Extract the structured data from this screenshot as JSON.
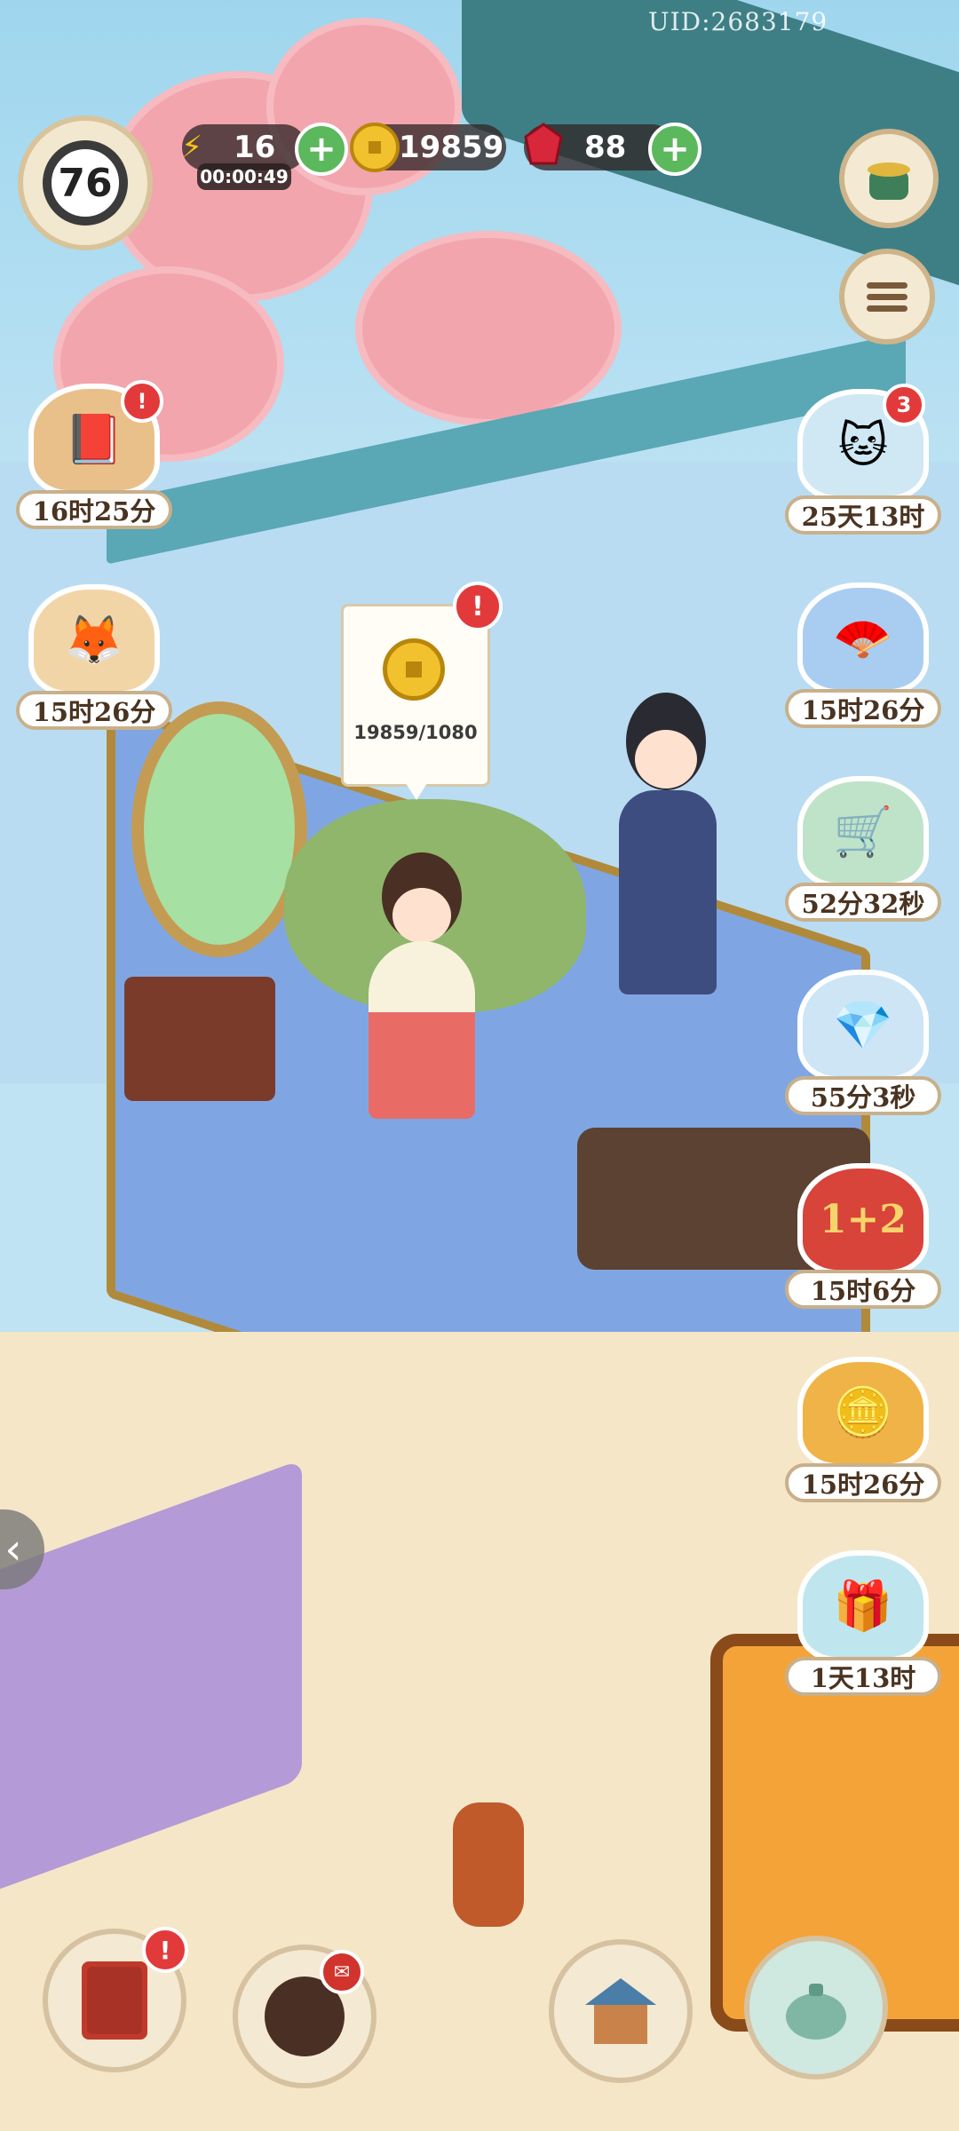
{
  "uid": "UID:2683179",
  "player": {
    "level": "76"
  },
  "resources": {
    "energy": {
      "icon": "lightning-icon",
      "value": "16",
      "timer": "00:00:49"
    },
    "coins": {
      "icon": "coin-icon",
      "value": "19859"
    },
    "gems": {
      "icon": "red-gem-icon",
      "value": "88"
    }
  },
  "tooltip": {
    "value": "19859/1080"
  },
  "left_events": [
    {
      "name": "book-event",
      "timer": "16时25分",
      "alert": "!"
    },
    {
      "name": "fox-event",
      "timer": "15时26分"
    }
  ],
  "right_events": [
    {
      "name": "cat-cloud-event",
      "timer": "25天13时",
      "badge": "3"
    },
    {
      "name": "fan-event",
      "timer": "15时26分"
    },
    {
      "name": "cat-cart-event",
      "timer": "52分32秒"
    },
    {
      "name": "treasure-cloud-event",
      "timer": "55分3秒"
    },
    {
      "name": "bonus-event",
      "timer": "15时6分",
      "art_text": "1+2"
    },
    {
      "name": "coin-pack-event",
      "timer": "15时26分"
    },
    {
      "name": "gift-box-event",
      "timer": "1天13时"
    }
  ],
  "colors": {
    "accent_green": "#5cb85c",
    "alert_red": "#e23a3a",
    "label_border": "#c8b08b"
  }
}
